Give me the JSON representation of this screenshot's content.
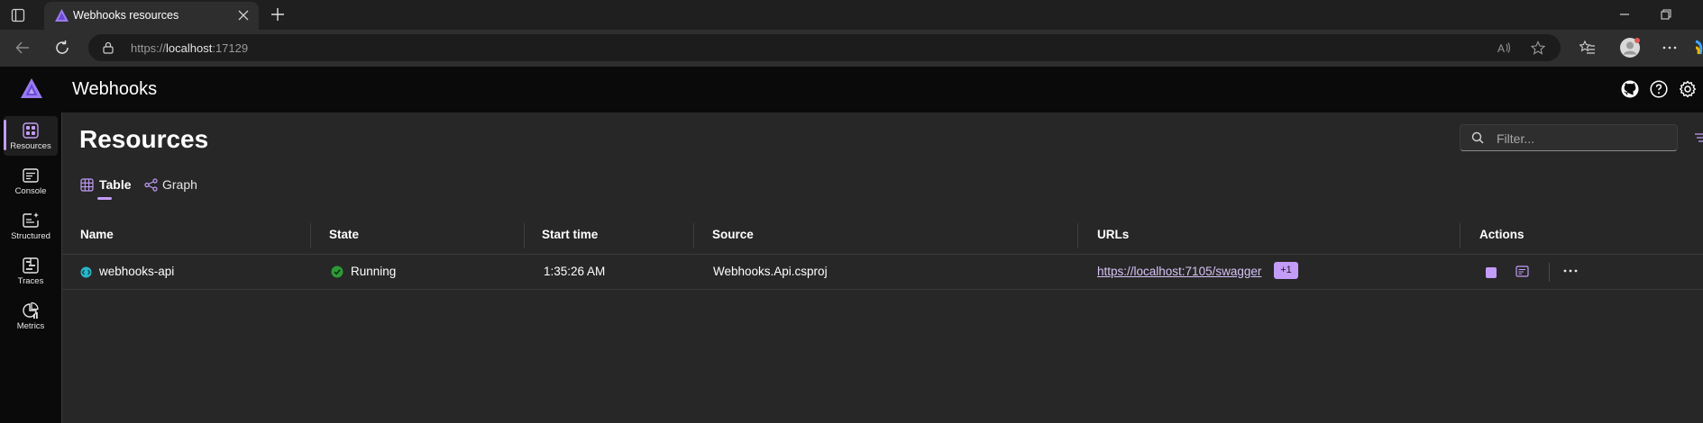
{
  "browser": {
    "tab_title": "Webhooks resources",
    "url_scheme": "https://",
    "url_host": "localhost",
    "url_port": ":17129"
  },
  "app": {
    "title": "Webhooks",
    "accent": "#c39cf7"
  },
  "sidebar": {
    "items": [
      {
        "label": "Resources",
        "icon": "resources-icon"
      },
      {
        "label": "Console",
        "icon": "console-icon"
      },
      {
        "label": "Structured",
        "icon": "structured-icon"
      },
      {
        "label": "Traces",
        "icon": "traces-icon"
      },
      {
        "label": "Metrics",
        "icon": "metrics-icon"
      }
    ]
  },
  "main": {
    "page_title": "Resources",
    "filter_placeholder": "Filter...",
    "tabs": [
      {
        "label": "Table",
        "selected": true
      },
      {
        "label": "Graph",
        "selected": false
      }
    ],
    "columns": [
      "Name",
      "State",
      "Start time",
      "Source",
      "URLs",
      "Actions"
    ],
    "rows": [
      {
        "name": "webhooks-api",
        "state": "Running",
        "start_time": "1:35:26 AM",
        "source": "Webhooks.Api.csproj",
        "url": "https://localhost:7105/swagger",
        "url_more": "+1"
      }
    ]
  }
}
